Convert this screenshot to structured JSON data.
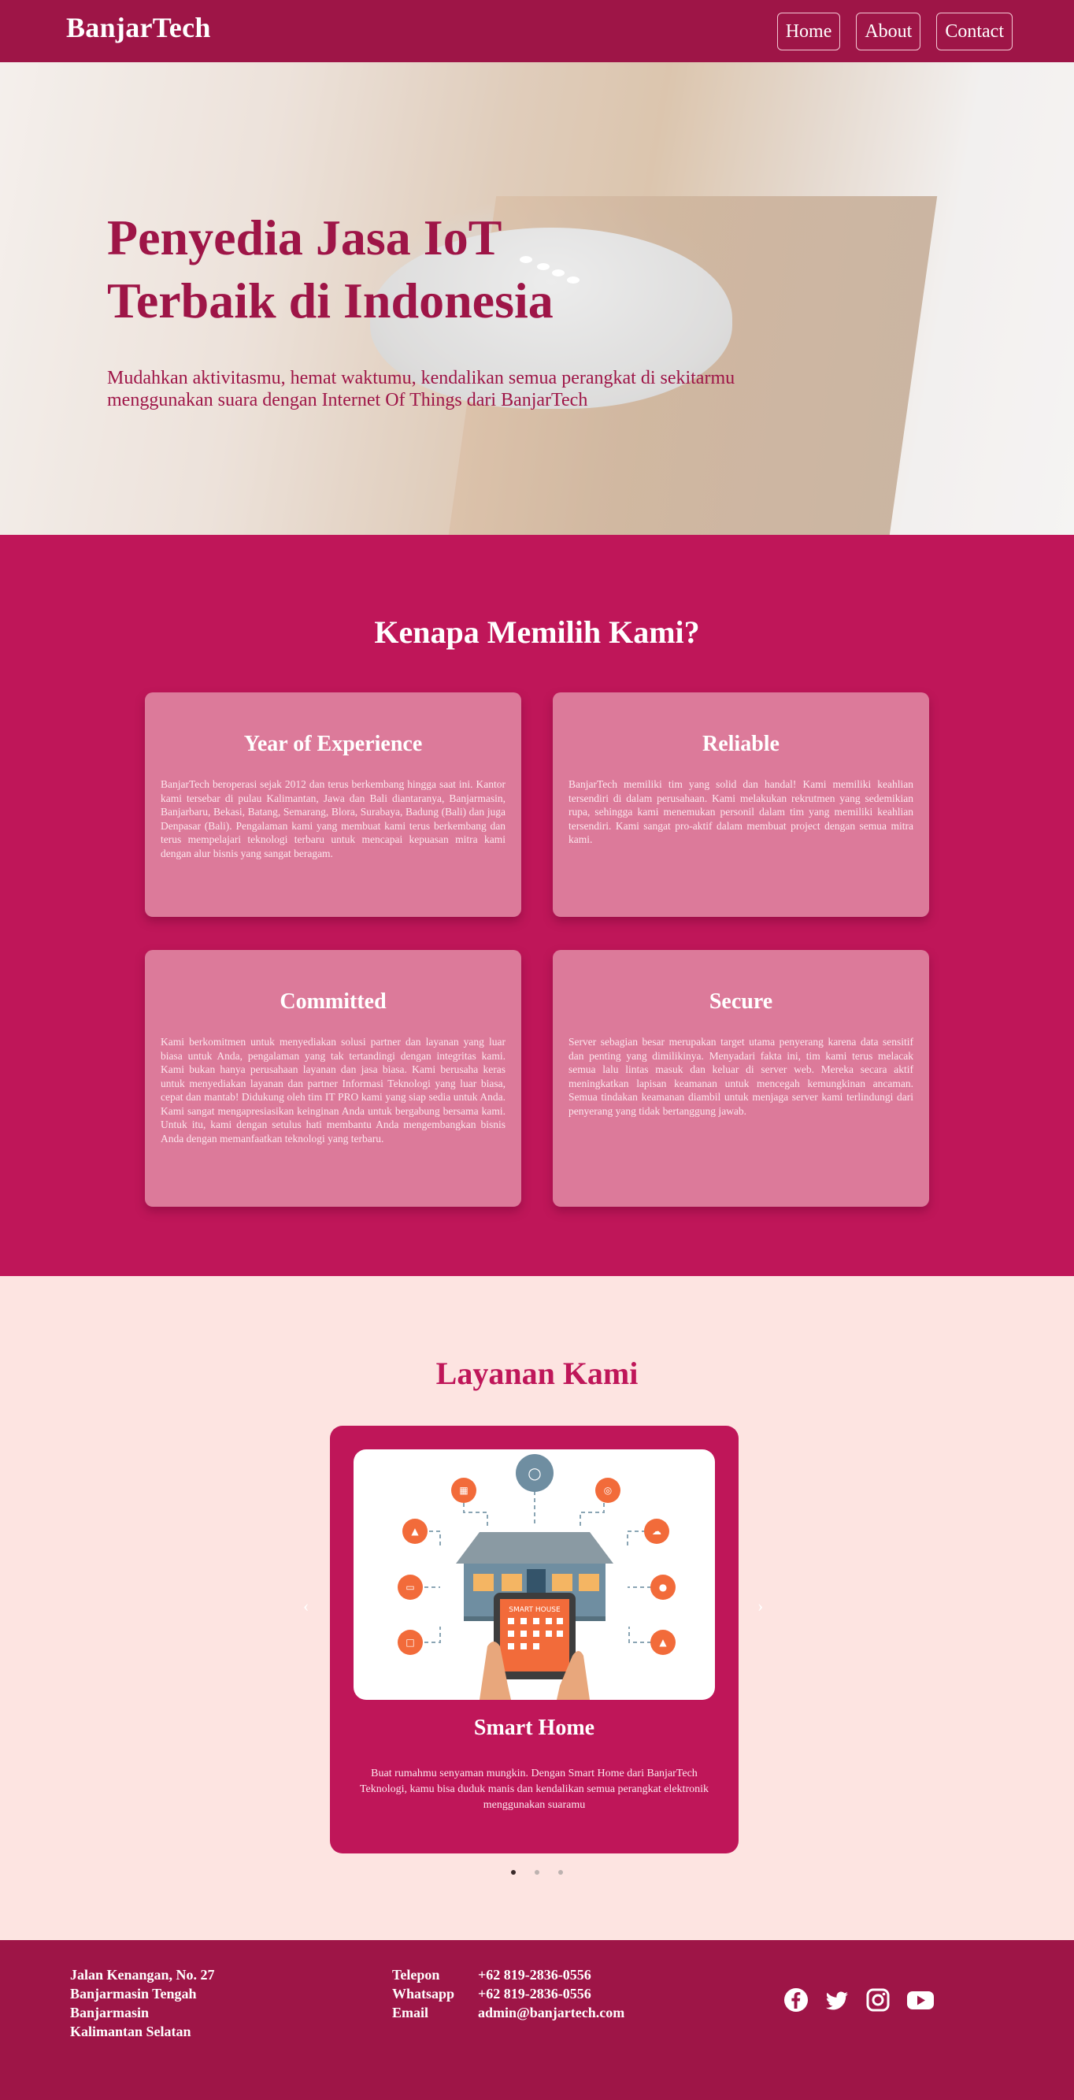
{
  "nav": {
    "brand": "BanjarTech",
    "links": [
      "Home",
      "About",
      "Contact"
    ]
  },
  "hero": {
    "title_line1": "Penyedia Jasa IoT",
    "title_line2": "Terbaik di Indonesia",
    "subtitle": "Mudahkan aktivitasmu, hemat waktumu, kendalikan semua perangkat di sekitarmu menggunakan suara dengan Internet Of Things dari BanjarTech"
  },
  "why": {
    "title": "Kenapa Memilih Kami?",
    "cards": [
      {
        "title": "Year of Experience",
        "text": "BanjarTech beroperasi sejak 2012 dan terus berkembang hingga saat ini. Kantor kami tersebar di pulau Kalimantan, Jawa dan Bali diantaranya, Banjarmasin, Banjarbaru, Bekasi, Batang, Semarang, Blora, Surabaya, Badung (Bali) dan juga Denpasar (Bali). Pengalaman kami yang membuat kami terus berkembang dan terus mempelajari teknologi terbaru untuk mencapai kepuasan mitra kami dengan alur bisnis yang sangat beragam."
      },
      {
        "title": "Reliable",
        "text": "BanjarTech memiliki tim yang solid dan handal! Kami memiliki keahlian tersendiri di dalam perusahaan. Kami melakukan rekrutmen yang sedemikian rupa, sehingga kami menemukan personil dalam tim yang memiliki keahlian tersendiri. Kami sangat pro-aktif dalam membuat project dengan semua mitra kami."
      },
      {
        "title": "Committed",
        "text": "Kami berkomitmen untuk menyediakan solusi partner dan layanan yang luar biasa untuk Anda, pengalaman yang tak tertandingi dengan integritas kami. Kami bukan hanya perusahaan layanan dan jasa biasa. Kami berusaha keras untuk menyediakan layanan dan partner Informasi Teknologi yang luar biasa, cepat dan mantab! Didukung oleh tim IT PRO kami yang siap sedia untuk Anda. Kami sangat mengapresiasikan keinginan Anda untuk bergabung bersama kami. Untuk itu, kami dengan setulus hati membantu Anda mengembangkan bisnis Anda dengan memanfaatkan teknologi yang terbaru."
      },
      {
        "title": "Secure",
        "text": "Server sebagian besar merupakan target utama penyerang karena data sensitif dan penting yang dimilikinya. Menyadari fakta ini, tim kami terus melacak semua lalu lintas masuk dan keluar di server web. Mereka secara aktif meningkatkan lapisan keamanan untuk mencegah kemungkinan ancaman. Semua tindakan keamanan diambil untuk menjaga server kami terlindungi dari penyerang yang tidak bertanggung jawab."
      }
    ]
  },
  "services": {
    "title": "Layanan Kami",
    "item": {
      "image_label": "SMART HOUSE",
      "title": "Smart Home",
      "text": "Buat rumahmu senyaman mungkin. Dengan Smart Home dari BanjarTech Teknologi, kamu bisa duduk manis dan kendalikan semua perangkat elektronik menggunakan suaramu"
    },
    "prev_icon": "chevron-left-icon",
    "next_icon": "chevron-right-icon",
    "slide_count": 3,
    "active_slide": 1
  },
  "footer": {
    "address": [
      "Jalan Kenangan, No. 27",
      "Banjarmasin Tengah",
      "Banjarmasin",
      "Kalimantan Selatan"
    ],
    "contacts": [
      {
        "label": "Telepon",
        "value": "+62 819-2836-0556"
      },
      {
        "label": "Whatsapp",
        "value": "+62 819-2836-0556"
      },
      {
        "label": "Email",
        "value": "admin@banjartech.com"
      }
    ],
    "socials": [
      "facebook-icon",
      "twitter-icon",
      "instagram-icon",
      "youtube-icon"
    ]
  },
  "colors": {
    "primary": "#9e1547",
    "section": "#bf1659",
    "card": "#dc7a9a",
    "light_bg": "#fde4e1",
    "accent_orange": "#f26b3a"
  }
}
